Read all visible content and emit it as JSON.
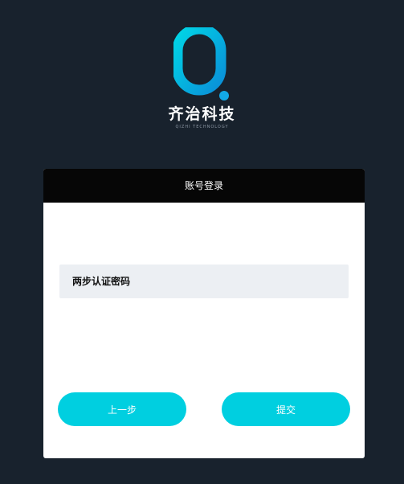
{
  "brand": {
    "name": "齐治科技",
    "subtitle": "QIZHI TECHNOLOGY",
    "logo_icon": "q-letter-logo-icon",
    "logo_color_start": "#00d6e6",
    "logo_color_end": "#0a8fd8"
  },
  "login_card": {
    "title": "账号登录",
    "twofa_label": "两步认证密码",
    "prev_button_label": "上一步",
    "submit_button_label": "提交"
  },
  "colors": {
    "background": "#18222d",
    "card_header": "#060606",
    "field_background": "#eceff3",
    "button": "#00cfe0"
  }
}
